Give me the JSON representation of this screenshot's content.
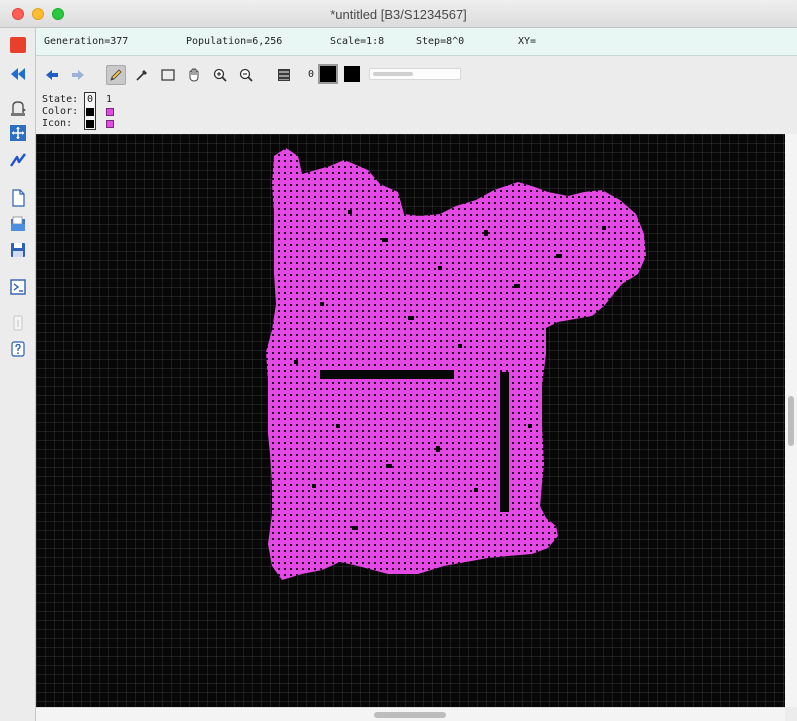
{
  "window": {
    "title": "*untitled [B3/S1234567]",
    "traffic_lights": {
      "close": "#ff5f57",
      "minimize": "#febc2e",
      "zoom": "#28c840"
    }
  },
  "status": {
    "generation": "Generation=377",
    "population": "Population=6,256",
    "scale": "Scale=1:8",
    "step": "Step=8^0",
    "xy": "XY="
  },
  "left_toolbar": {
    "icons": [
      "stop-icon",
      "rewind-icon",
      "algorithm-icon",
      "fit-icon",
      "step-icon",
      "new-pattern-icon",
      "open-pattern-icon",
      "save-pattern-icon",
      "script-icon",
      "info-icon",
      "help-icon"
    ]
  },
  "edit_toolbar": {
    "icons": [
      "undo-icon",
      "redo-icon",
      "pencil-draw-icon",
      "eyedropper-icon",
      "select-rect-icon",
      "move-hand-icon",
      "zoom-in-icon",
      "zoom-out-icon",
      "all-states-icon"
    ],
    "state_number": "0",
    "bg_color": "#000000",
    "fg_color": "#000000"
  },
  "layer_info": {
    "state_label": "State:",
    "color_label": "Color:",
    "icon_label": "Icon:",
    "state_values": [
      "0",
      "1"
    ],
    "state0_color": "#000000",
    "state1_color": "#e34ae3"
  },
  "canvas": {
    "background": "#070707",
    "cell_color": "#e34ae3",
    "grid_color": "#2e2e2e"
  }
}
